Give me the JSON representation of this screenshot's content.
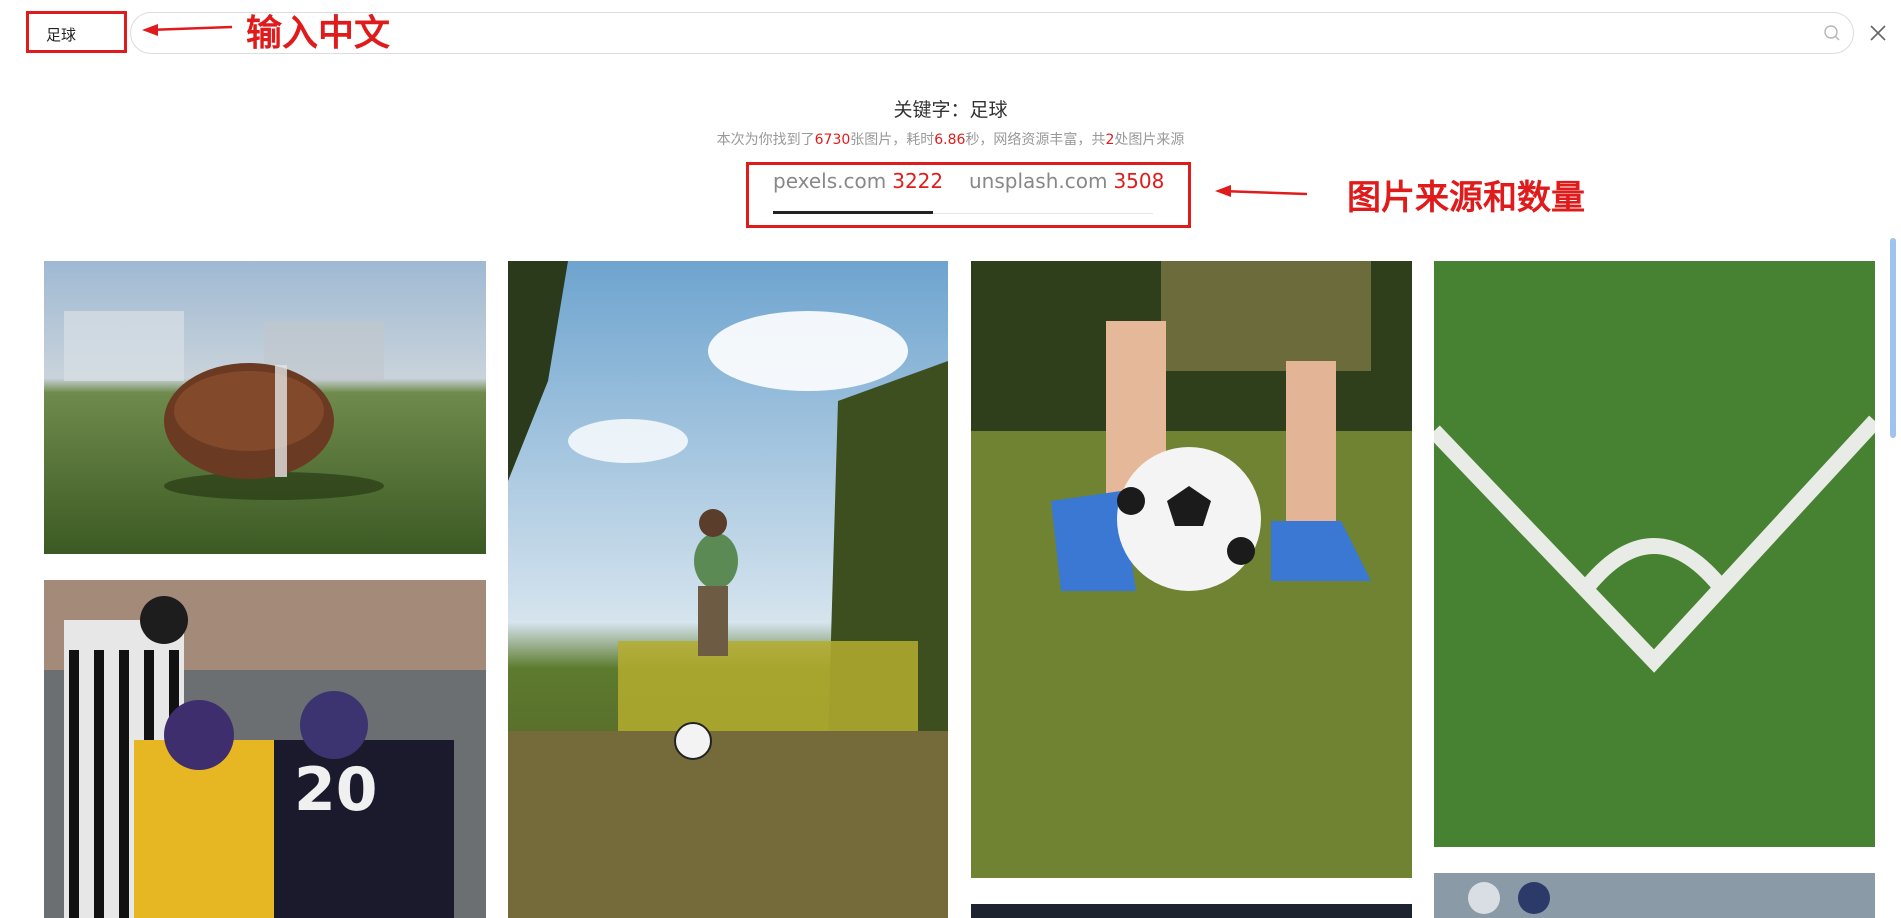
{
  "search": {
    "value": "足球",
    "close_icon": "close-icon",
    "search_icon": "search-icon"
  },
  "annotations": {
    "input_label": "输入中文",
    "sources_label": "图片来源和数量",
    "color": "#e01b1b"
  },
  "summary": {
    "keyword_line": "关键字：足球",
    "stats": {
      "prefix": "本次为你找到了",
      "total": "6730",
      "mid1": "张图片，耗时",
      "seconds": "6.86",
      "mid2": "秒，网络资源丰富，共",
      "source_count": "2",
      "suffix": "处图片来源"
    }
  },
  "tabs": [
    {
      "label": "pexels.com",
      "count": "3222",
      "active": true
    },
    {
      "label": "unsplash.com",
      "count": "3508",
      "active": false
    }
  ],
  "images": [
    {
      "name": "american-football-on-grass"
    },
    {
      "name": "boy-kicking-soccer-ball-in-park"
    },
    {
      "name": "child-legs-with-soccer-ball"
    },
    {
      "name": "turf-corner-lines"
    },
    {
      "name": "american-football-game-action"
    },
    {
      "name": "dark-stadium-photo"
    },
    {
      "name": "players-on-field"
    }
  ],
  "colors": {
    "accent": "#e01b1b",
    "tab_active_underline": "#222222",
    "scrollbar": "#9ec3f0"
  }
}
